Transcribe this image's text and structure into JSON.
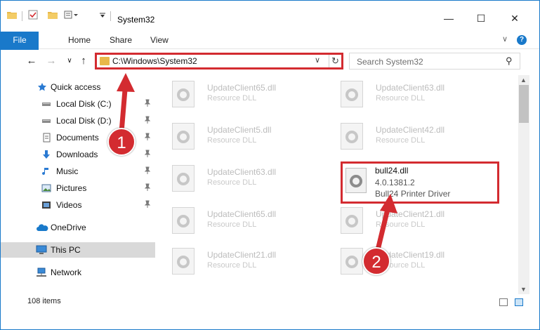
{
  "window": {
    "title": "System32",
    "minimize_glyph": "—",
    "maximize_glyph": "☐",
    "close_glyph": "✕"
  },
  "ribbon": {
    "tabs": [
      "File",
      "Home",
      "Share",
      "View"
    ],
    "expand_glyph": "∨",
    "help_glyph": "?"
  },
  "nav": {
    "back_glyph": "←",
    "forward_glyph": "→",
    "recent_glyph": "∨",
    "up_glyph": "↑",
    "address": "C:\\Windows\\System32",
    "address_dropdown_glyph": "∨",
    "refresh_glyph": "↻",
    "search_placeholder": "Search System32",
    "search_glyph": "⚲"
  },
  "navpane": {
    "items": [
      {
        "label": "Quick access",
        "icon": "star-icon",
        "pinned": false
      },
      {
        "label": "Local Disk (C:)",
        "icon": "drive-icon",
        "pinned": true
      },
      {
        "label": "Local Disk (D:)",
        "icon": "drive-icon",
        "pinned": true
      },
      {
        "label": "Documents",
        "icon": "documents-icon",
        "pinned": true
      },
      {
        "label": "Downloads",
        "icon": "download-icon",
        "pinned": true
      },
      {
        "label": "Music",
        "icon": "music-icon",
        "pinned": true
      },
      {
        "label": "Pictures",
        "icon": "pictures-icon",
        "pinned": true
      },
      {
        "label": "Videos",
        "icon": "videos-icon",
        "pinned": true
      },
      {
        "label": "OneDrive",
        "icon": "cloud-icon",
        "pinned": false
      },
      {
        "label": "This PC",
        "icon": "computer-icon",
        "pinned": false,
        "selected": true
      },
      {
        "label": "Network",
        "icon": "network-icon",
        "pinned": false
      }
    ],
    "pin_glyph": "📌"
  },
  "files": [
    {
      "name": "UpdateClient65.dll",
      "type": "Resource DLL"
    },
    {
      "name": "UpdateClient63.dll",
      "type": "Resource DLL"
    },
    {
      "name": "UpdateClient5.dll",
      "type": "Resource DLL"
    },
    {
      "name": "UpdateClient42.dll",
      "type": "Resource DLL"
    },
    {
      "name": "UpdateClient63.dll",
      "type": "Resource DLL"
    },
    {
      "name": "UpdateClient65.dll",
      "type": "Resource DLL"
    },
    {
      "name": "UpdateClient21.dll",
      "type": "Resource DLL"
    },
    {
      "name": "UpdateClient21.dll",
      "type": "Resource DLL"
    },
    {
      "name": "UpdateClient19.dll",
      "type": "Resource DLL"
    }
  ],
  "highlighted_file": {
    "name": "bull24.dll",
    "version": "4.0.1381.2",
    "description": "Bull24 Printer Driver"
  },
  "status": {
    "item_count": "108 items"
  },
  "annotations": {
    "step1": "1",
    "step2": "2",
    "color": "#d32b30"
  }
}
